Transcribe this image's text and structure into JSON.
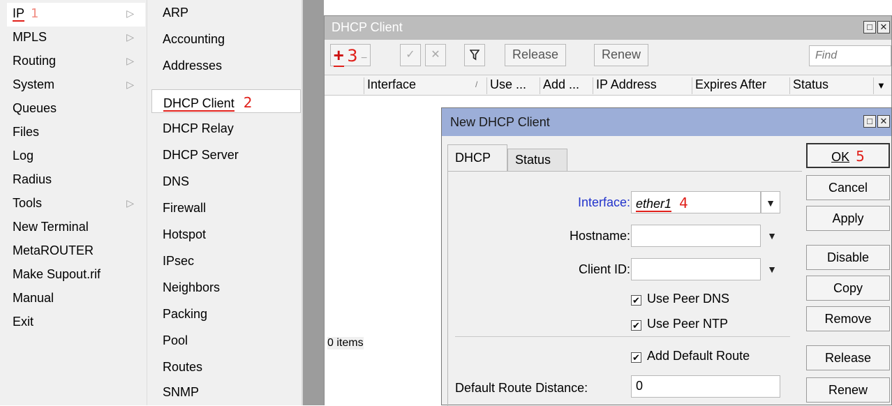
{
  "main_menu": {
    "items": [
      {
        "label": "IP",
        "selected": true,
        "has_submenu": true,
        "annotation": "1"
      },
      {
        "label": "MPLS",
        "has_submenu": true
      },
      {
        "label": "Routing",
        "has_submenu": true
      },
      {
        "label": "System",
        "has_submenu": true
      },
      {
        "label": "Queues"
      },
      {
        "label": "Files"
      },
      {
        "label": "Log"
      },
      {
        "label": "Radius"
      },
      {
        "label": "Tools",
        "has_submenu": true
      },
      {
        "label": "New Terminal"
      },
      {
        "label": "MetaROUTER"
      },
      {
        "label": "Make Supout.rif"
      },
      {
        "label": "Manual"
      },
      {
        "label": "Exit"
      }
    ],
    "submenu_arrow": "▷"
  },
  "sub_menu": {
    "items": [
      {
        "label": "ARP"
      },
      {
        "label": "Accounting"
      },
      {
        "label": "Addresses"
      },
      {
        "label": "DHCP Client",
        "selected": true,
        "annotation": "2"
      },
      {
        "label": "DHCP Relay"
      },
      {
        "label": "DHCP Server"
      },
      {
        "label": "DNS"
      },
      {
        "label": "Firewall"
      },
      {
        "label": "Hotspot"
      },
      {
        "label": "IPsec"
      },
      {
        "label": "Neighbors"
      },
      {
        "label": "Packing"
      },
      {
        "label": "Pool"
      },
      {
        "label": "Routes"
      },
      {
        "label": "SNMP"
      }
    ]
  },
  "dhcp_window": {
    "title": "DHCP Client",
    "window_buttons": [
      "□",
      "✕"
    ],
    "toolbar": {
      "add_icon": "+",
      "add_annotation": "3",
      "remove_icon": "−",
      "enable_icon": "✓",
      "disable_icon": "✕",
      "filter_icon": "filter-icon",
      "release_label": "Release",
      "renew_label": "Renew",
      "find_placeholder": "Find"
    },
    "columns": [
      "Interface",
      "Use ...",
      "Add ...",
      "IP Address",
      "Expires After",
      "Status"
    ],
    "sort_marker": "/",
    "column_menu_icon": "▼",
    "items_count": "0 items"
  },
  "new_dialog": {
    "title": "New DHCP Client",
    "window_buttons": [
      "□",
      "✕"
    ],
    "tabs": [
      "DHCP",
      "Status"
    ],
    "fields": {
      "interface_label": "Interface:",
      "interface_value": "ether1",
      "interface_annotation": "4",
      "hostname_label": "Hostname:",
      "hostname_value": "",
      "client_id_label": "Client ID:",
      "client_id_value": "",
      "use_peer_dns_label": "Use Peer DNS",
      "use_peer_ntp_label": "Use Peer NTP",
      "add_default_route_label": "Add Default Route",
      "default_route_distance_label": "Default Route Distance:",
      "default_route_distance_value": "0"
    },
    "checkbox_mark": "✔",
    "dropdown_icon": "▼",
    "buttons": {
      "ok": "OK",
      "ok_annotation": "5",
      "cancel": "Cancel",
      "apply": "Apply",
      "disable": "Disable",
      "copy": "Copy",
      "remove": "Remove",
      "release": "Release",
      "renew": "Renew"
    }
  },
  "colors": {
    "annotation": "#e0201a",
    "dialog_titlebar": "#9caed8",
    "window_titlebar": "#bcbcbc",
    "interface_label": "#2233cc"
  }
}
